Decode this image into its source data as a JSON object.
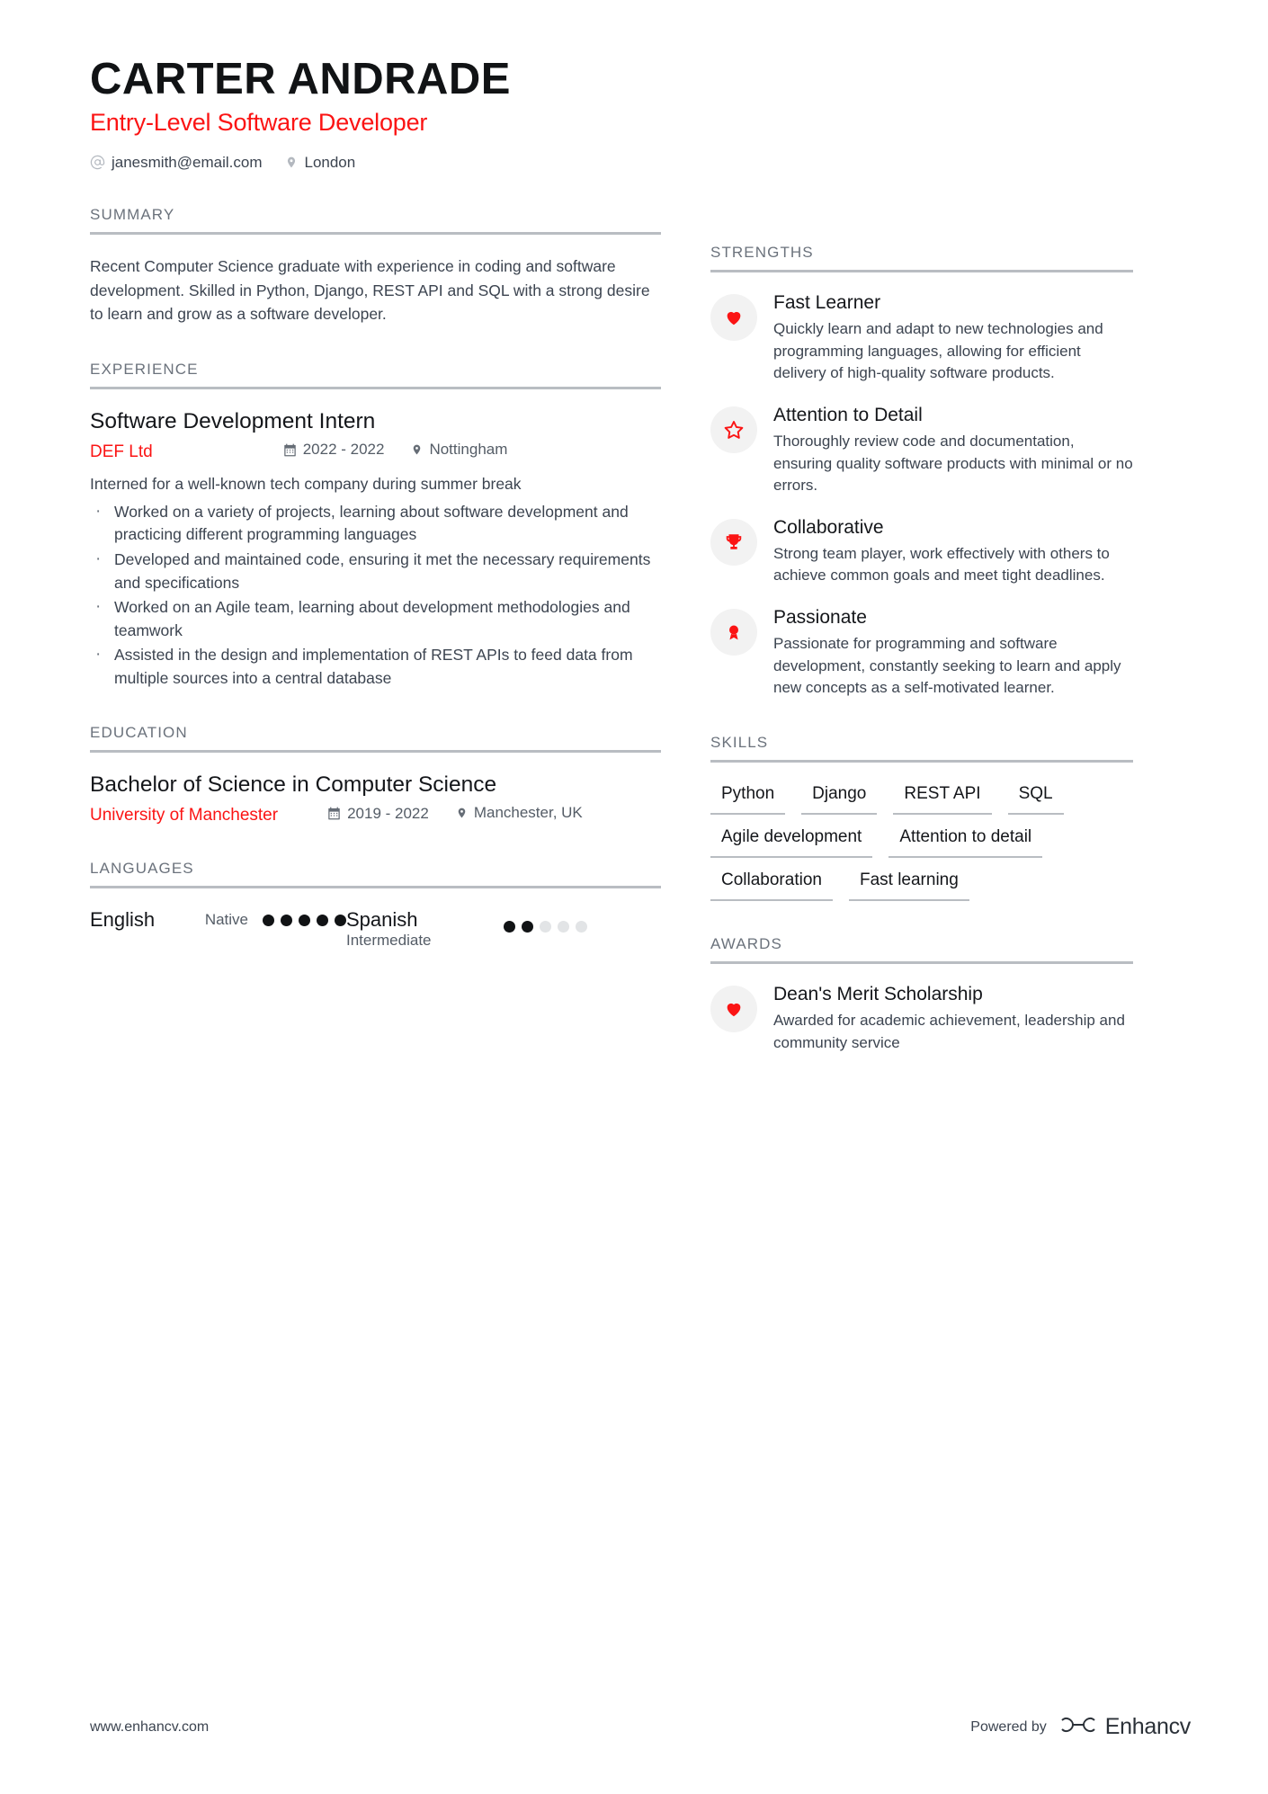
{
  "header": {
    "name": "CARTER ANDRADE",
    "job_title": "Entry-Level Software Developer",
    "email": "janesmith@email.com",
    "email_icon": "at-icon",
    "location": "London",
    "location_icon": "location-pin-icon"
  },
  "summary": {
    "heading": "SUMMARY",
    "text": "Recent Computer Science graduate with experience in coding and software development. Skilled in Python, Django, REST API and SQL with a strong desire to learn and grow as a software developer."
  },
  "experience": {
    "heading": "EXPERIENCE",
    "entries": [
      {
        "title": "Software Development Intern",
        "company": "DEF Ltd",
        "dates": "2022 - 2022",
        "dates_icon": "calendar-icon",
        "location": "Nottingham",
        "location_icon": "location-pin-icon",
        "description": "Interned for a well-known tech company during summer break",
        "bullets": [
          "Worked on a variety of projects, learning about software development and practicing different programming languages",
          "Developed and maintained code, ensuring it met the necessary requirements and specifications",
          "Worked on an Agile team, learning about development methodologies and teamwork",
          "Assisted in the design and implementation of REST APIs to feed data from multiple sources into a central database"
        ]
      }
    ]
  },
  "education": {
    "heading": "EDUCATION",
    "entries": [
      {
        "degree": "Bachelor of Science in Computer Science",
        "school": "University of Manchester",
        "dates": "2019 - 2022",
        "dates_icon": "calendar-icon",
        "location": "Manchester, UK",
        "location_icon": "location-pin-icon"
      }
    ]
  },
  "languages": {
    "heading": "LANGUAGES",
    "items": [
      {
        "name": "English",
        "level": "Native",
        "rating": 5,
        "max": 5
      },
      {
        "name": "Spanish",
        "level": "Intermediate",
        "rating": 2,
        "max": 5
      }
    ]
  },
  "strengths": {
    "heading": "STRENGTHS",
    "items": [
      {
        "icon": "heart-icon",
        "title": "Fast Learner",
        "desc": "Quickly learn and adapt to new technologies and programming languages, allowing for efficient delivery of high-quality software products."
      },
      {
        "icon": "star-outline-icon",
        "title": "Attention to Detail",
        "desc": "Thoroughly review code and documentation, ensuring quality software products with minimal or no errors."
      },
      {
        "icon": "trophy-icon",
        "title": "Collaborative",
        "desc": "Strong team player, work effectively with others to achieve common goals and meet tight deadlines."
      },
      {
        "icon": "medal-icon",
        "title": "Passionate",
        "desc": "Passionate for programming and software development, constantly seeking to learn and apply new concepts as a self-motivated learner."
      }
    ]
  },
  "skills": {
    "heading": "SKILLS",
    "items": [
      "Python",
      "Django",
      "REST API",
      "SQL",
      "Agile development",
      "Attention to detail",
      "Collaboration",
      "Fast learning"
    ]
  },
  "awards": {
    "heading": "AWARDS",
    "items": [
      {
        "icon": "heart-icon",
        "title": "Dean's Merit Scholarship",
        "desc": "Awarded for academic achievement, leadership and community service"
      }
    ]
  },
  "footer": {
    "url": "www.enhancv.com",
    "powered_by": "Powered by",
    "brand": "Enhancv",
    "brand_logo": "enhancv-logo-icon"
  },
  "colors": {
    "accent": "#fb1414",
    "text": "#3c4450",
    "heading": "#6b727c",
    "rule": "#b9bdc2"
  }
}
